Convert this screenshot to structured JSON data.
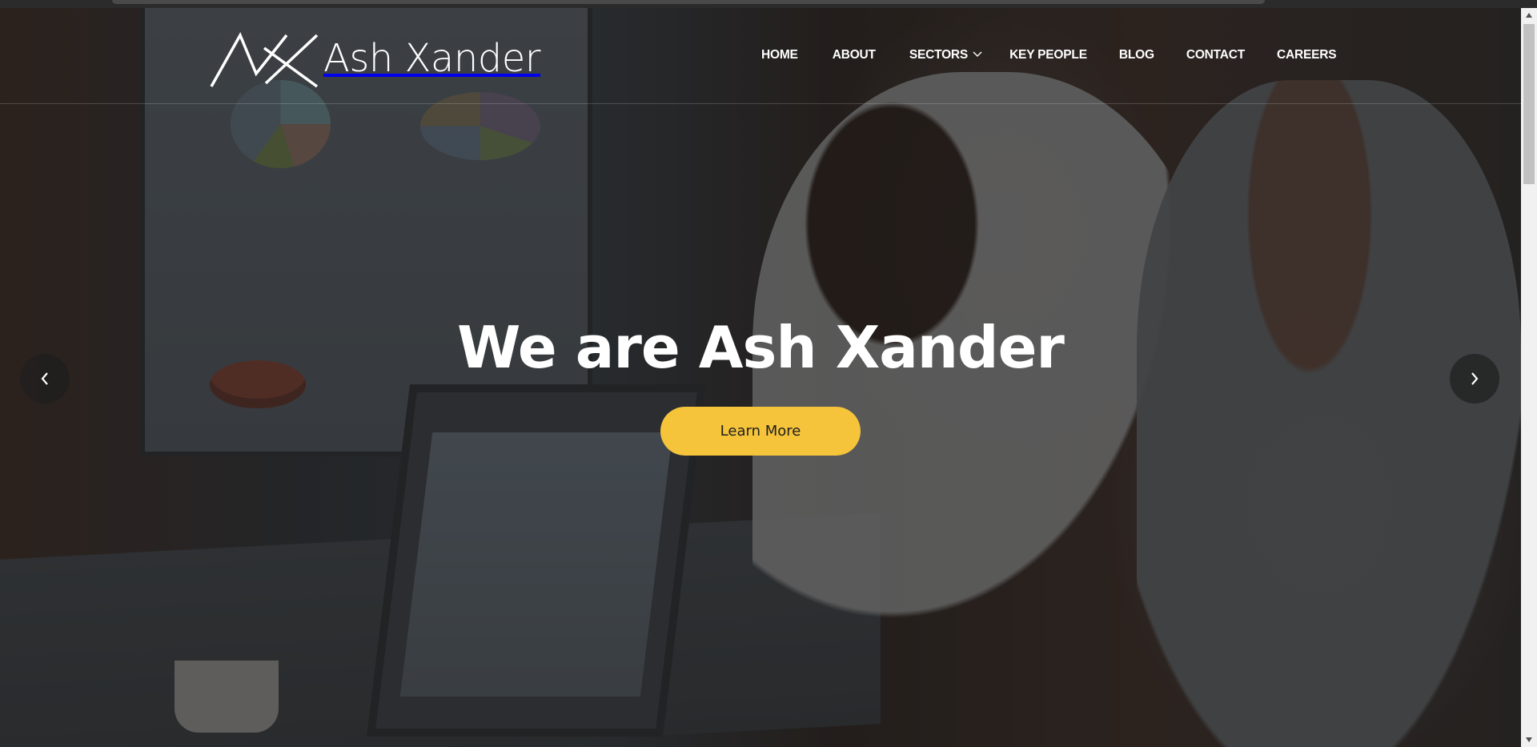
{
  "brand": {
    "name": "Ash Xander",
    "logo_icon": "ax-monogram-icon"
  },
  "nav": {
    "items": [
      {
        "label": "HOME"
      },
      {
        "label": "ABOUT"
      },
      {
        "label": "SECTORS",
        "has_dropdown": true
      },
      {
        "label": "KEY PEOPLE"
      },
      {
        "label": "BLOG"
      },
      {
        "label": "CONTACT"
      },
      {
        "label": "CAREERS"
      }
    ]
  },
  "hero": {
    "title": "We are Ash Xander",
    "cta_label": "Learn More",
    "prev_icon": "chevron-left-icon",
    "next_icon": "chevron-right-icon"
  },
  "colors": {
    "accent": "#f5c43a",
    "text": "#ffffff",
    "arrow_bg": "#1e1e1e"
  }
}
